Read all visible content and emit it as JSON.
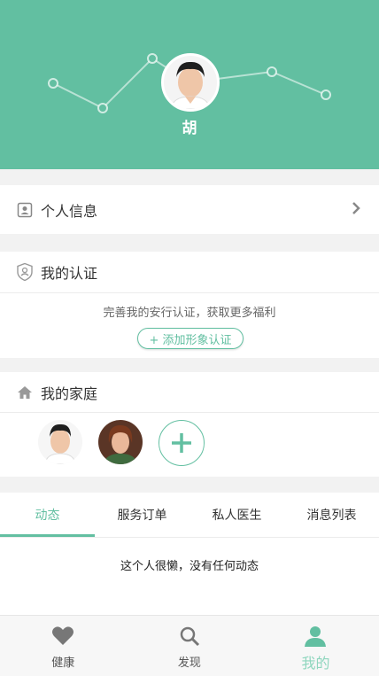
{
  "colors": {
    "accent": "#62bfa1",
    "background": "#f2f2f2"
  },
  "profile": {
    "name": "胡"
  },
  "personal_info": {
    "label": "个人信息",
    "icon": "id-card-icon"
  },
  "certification": {
    "title": "我的认证",
    "icon": "shield-user-icon",
    "tip": "完善我的安行认证，获取更多福利",
    "button_label": "+ 添加形象认证"
  },
  "family": {
    "title": "我的家庭",
    "icon": "home-icon",
    "members": [
      "member-1",
      "member-2"
    ],
    "add_icon": "plus-icon"
  },
  "tabs": {
    "items": [
      {
        "label": "动态"
      },
      {
        "label": "服务订单"
      },
      {
        "label": "私人医生"
      },
      {
        "label": "消息列表"
      }
    ],
    "active_index": 0,
    "empty_text": "这个人很懒，没有任何动态"
  },
  "tabbar": {
    "items": [
      {
        "label": "健康",
        "icon": "heart-icon"
      },
      {
        "label": "发现",
        "icon": "search-icon"
      },
      {
        "label": "我的",
        "icon": "user-icon"
      }
    ],
    "active_index": 2
  }
}
